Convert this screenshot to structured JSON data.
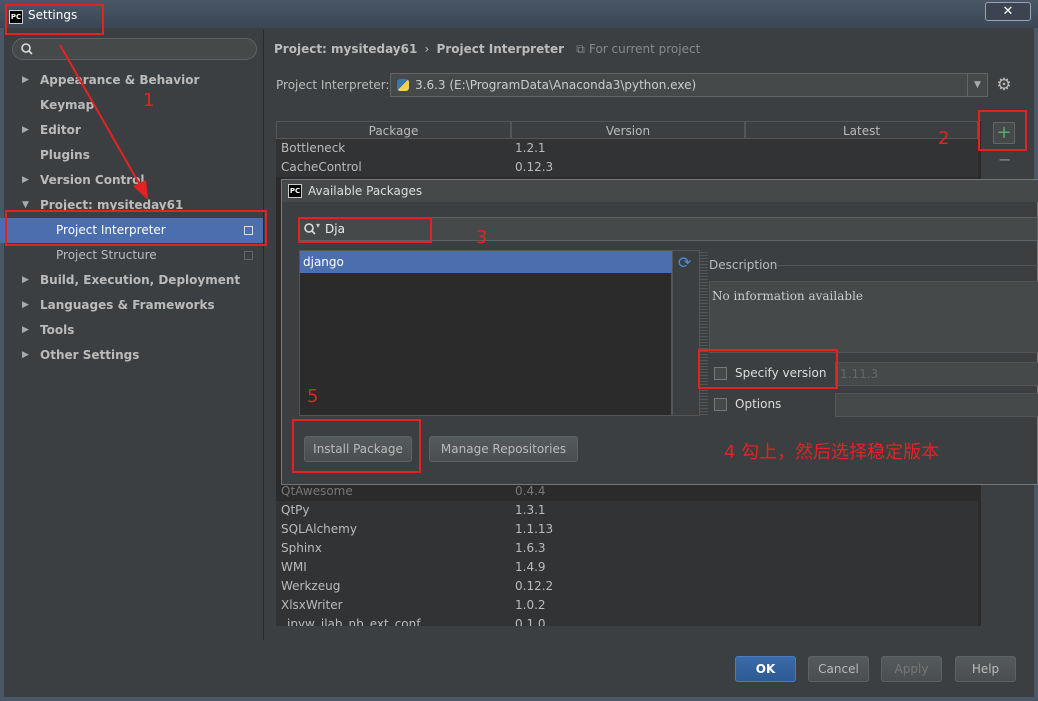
{
  "window": {
    "title": "Settings",
    "app_icon": "PC",
    "close_label": "✕"
  },
  "search": {
    "value": ""
  },
  "sidebar": {
    "items": [
      {
        "label": "Appearance & Behavior",
        "arrow": "▶"
      },
      {
        "label": "Keymap",
        "arrow": ""
      },
      {
        "label": "Editor",
        "arrow": "▶"
      },
      {
        "label": "Plugins",
        "arrow": ""
      },
      {
        "label": "Version Control",
        "arrow": "▶"
      },
      {
        "label": "Project: mysiteday61",
        "arrow": "▼"
      },
      {
        "label": "Project Interpreter",
        "arrow": ""
      },
      {
        "label": "Project Structure",
        "arrow": ""
      },
      {
        "label": "Build, Execution, Deployment",
        "arrow": "▶"
      },
      {
        "label": "Languages & Frameworks",
        "arrow": "▶"
      },
      {
        "label": "Tools",
        "arrow": "▶"
      },
      {
        "label": "Other Settings",
        "arrow": "▶"
      }
    ]
  },
  "breadcrumb": {
    "project": "Project: mysiteday61",
    "sep": "›",
    "page": "Project Interpreter",
    "scope": "For current project"
  },
  "interpreter": {
    "label": "Project Interpreter:",
    "value": "3.6.3 (E:\\ProgramData\\Anaconda3\\python.exe)"
  },
  "table": {
    "headers": [
      "Package",
      "Version",
      "Latest"
    ],
    "top_rows": [
      {
        "package": "Bottleneck",
        "version": "1.2.1"
      },
      {
        "package": "CacheControl",
        "version": "0.12.3"
      }
    ],
    "bottom_rows": [
      {
        "package": "QtAwesome",
        "version": "0.4.4"
      },
      {
        "package": "QtPy",
        "version": "1.3.1"
      },
      {
        "package": "SQLAlchemy",
        "version": "1.1.13"
      },
      {
        "package": "Sphinx",
        "version": "1.6.3"
      },
      {
        "package": "WMI",
        "version": "1.4.9"
      },
      {
        "package": "Werkzeug",
        "version": "0.12.2"
      },
      {
        "package": "XlsxWriter",
        "version": "1.0.2"
      },
      {
        "package": "_ipyw_jlab_nb_ext_conf",
        "version": "0.1.0"
      }
    ]
  },
  "side_buttons": {
    "add": "+",
    "remove": "−"
  },
  "dialog": {
    "title": "Available Packages",
    "search_value": "Dja",
    "results": [
      "django"
    ],
    "description_label": "Description",
    "description_text": "No information available",
    "specify_version_label": "Specify version",
    "version_value": "1.11.3",
    "options_label": "Options",
    "install_label": "Install Package",
    "manage_label": "Manage Repositories"
  },
  "annotations": [
    "1",
    "2",
    "3",
    "4 勾上，然后选择稳定版本",
    "5"
  ],
  "footer": {
    "ok": "OK",
    "cancel": "Cancel",
    "apply": "Apply",
    "help": "Help"
  },
  "colors": {
    "accent": "#4b6eaf",
    "annotation": "#e52222",
    "add_icon": "#59a869"
  }
}
